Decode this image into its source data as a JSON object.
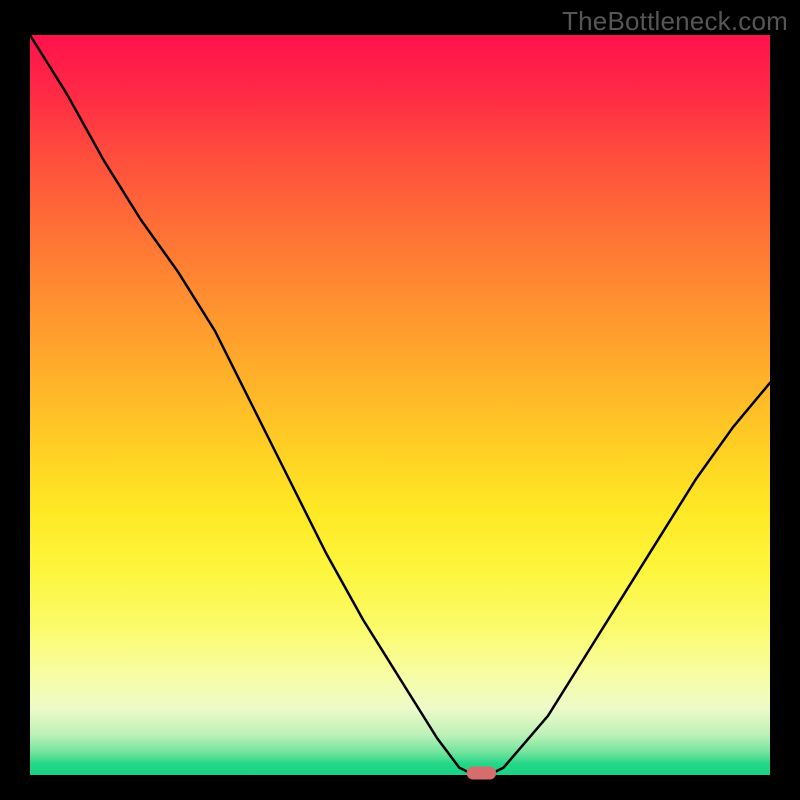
{
  "watermark": "TheBottleneck.com",
  "chart_data": {
    "type": "line",
    "title": "",
    "xlabel": "",
    "ylabel": "",
    "xlim": [
      0,
      100
    ],
    "ylim": [
      0,
      100
    ],
    "x": [
      0,
      5,
      10,
      15,
      20,
      25,
      30,
      35,
      40,
      45,
      50,
      55,
      58,
      60,
      62,
      64,
      70,
      75,
      80,
      85,
      90,
      95,
      100
    ],
    "y": [
      100,
      92,
      83,
      75,
      68,
      60,
      50,
      40,
      30,
      21,
      13,
      5,
      1,
      0,
      0,
      1,
      8,
      16,
      24,
      32,
      40,
      47,
      53
    ],
    "marker": {
      "x_center": 61,
      "y": 0,
      "width": 4,
      "color": "#d56d6d"
    },
    "background_gradient": {
      "stops": [
        {
          "pos": 0.0,
          "color": "#ff124c"
        },
        {
          "pos": 0.3,
          "color": "#ff7a33"
        },
        {
          "pos": 0.6,
          "color": "#ffe225"
        },
        {
          "pos": 0.85,
          "color": "#f9fd8f"
        },
        {
          "pos": 0.97,
          "color": "#6fe39c"
        },
        {
          "pos": 1.0,
          "color": "#18d184"
        }
      ]
    }
  }
}
